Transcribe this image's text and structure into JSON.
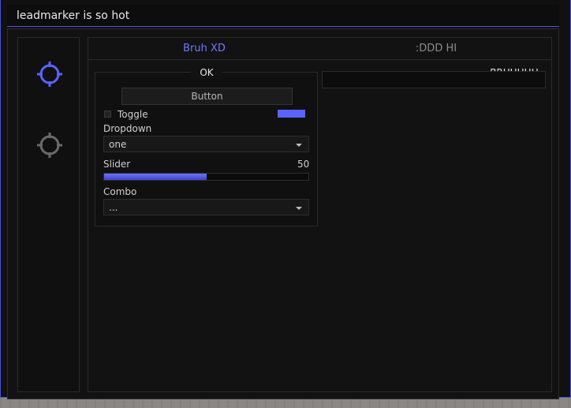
{
  "window": {
    "title": "leadmarker is so hot"
  },
  "colors": {
    "accent": "#5a63ff",
    "background": "#111111",
    "border": "#2a2a2a"
  },
  "sidebar": {
    "items": [
      {
        "icon": "crosshair-icon",
        "active": true
      },
      {
        "icon": "crosshair-icon",
        "active": false
      }
    ]
  },
  "tabs": [
    {
      "label": "Bruh XD",
      "active": true
    },
    {
      "label": ":DDD HI",
      "active": false
    }
  ],
  "left_panel": {
    "title": "OK",
    "button_label": "Button",
    "toggle": {
      "label": "Toggle",
      "checked": false,
      "color": "#5a63ff"
    },
    "dropdown": {
      "label": "Dropdown",
      "value": "one"
    },
    "slider": {
      "label": "Slider",
      "value": "50",
      "fraction": 0.5
    },
    "combo": {
      "label": "Combo",
      "value": "..."
    }
  },
  "right_panel": {
    "title": "BRUHHHH"
  }
}
